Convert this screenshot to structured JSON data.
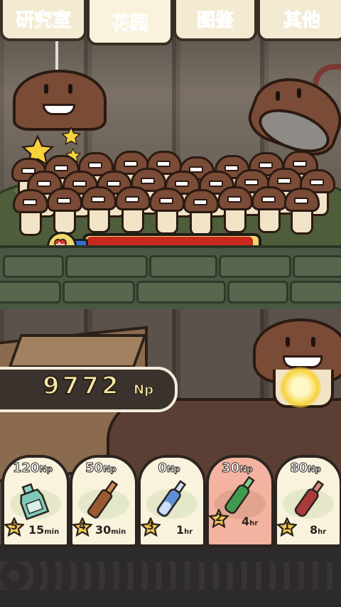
{
  "tabs": [
    {
      "label": "研究室",
      "active": false
    },
    {
      "label": "花园",
      "active": true
    },
    {
      "label": "图鉴",
      "active": false
    },
    {
      "label": "其他",
      "active": false
    }
  ],
  "health": {
    "level": 1.0,
    "color": "#c8281d",
    "icon": "heart-icon"
  },
  "currency": {
    "value": "9772",
    "unit": "Np"
  },
  "items": [
    {
      "cost": "120",
      "cost_unit": "Np",
      "level": "5",
      "duration": "15",
      "duration_unit": "min",
      "icon": "green-bottle-icon",
      "selected": false
    },
    {
      "cost": "50",
      "cost_unit": "Np",
      "level": "4",
      "duration": "30",
      "duration_unit": "min",
      "icon": "brown-vial-icon",
      "selected": false
    },
    {
      "cost": "0",
      "cost_unit": "Np",
      "level": "3",
      "duration": "1",
      "duration_unit": "hr",
      "icon": "blue-ampoule-icon",
      "selected": false
    },
    {
      "cost": "30",
      "cost_unit": "Np",
      "level": "2",
      "duration": "4",
      "duration_unit": "hr",
      "icon": "green-ampoule-icon",
      "selected": true
    },
    {
      "cost": "80",
      "cost_unit": "Np",
      "level": "1",
      "duration": "8",
      "duration_unit": "hr",
      "icon": "red-ampoule-icon",
      "selected": false
    }
  ],
  "colors": {
    "accent": "#f2c84a",
    "selected_card": "#f3b3a0",
    "card": "#f9f3de"
  }
}
